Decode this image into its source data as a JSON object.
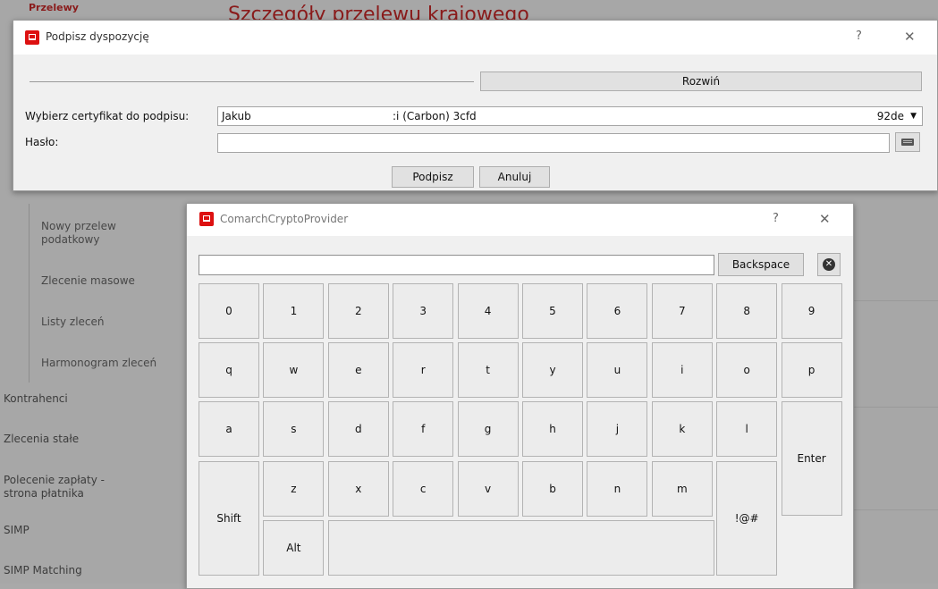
{
  "background": {
    "breadcrumb": "Przelewy",
    "heading": "Szczegóły przelewu krajowego",
    "nav": {
      "tax_transfer": "Nowy przelew\npodatkowy",
      "mass_order": "Zlecenie masowe",
      "order_lists": "Listy zleceń",
      "order_schedule": "Harmonogram zleceń",
      "contractors": "Kontrahenci",
      "standing_orders": "Zlecenia stałe",
      "direct_debit": "Polecenie zapłaty -\nstrona płatnika",
      "simp": "SIMP",
      "simp_matching": "SIMP Matching"
    }
  },
  "sign_dialog": {
    "title": "Podpisz dyspozycję",
    "help": "?",
    "close": "✕",
    "expand_label": "Rozwiń",
    "certificate_label": "Wybierz certyfikat do podpisu:",
    "certificate_value_start": "Jakub",
    "certificate_value_mid": ":i (Carbon) 3cfd",
    "certificate_value_end": "92de",
    "password_label": "Hasło:",
    "password_value": "",
    "sign_label": "Podpisz",
    "cancel_label": "Anuluj"
  },
  "keyboard_dialog": {
    "title": "ComarchCryptoProvider",
    "help": "?",
    "close": "✕",
    "input_value": "",
    "backspace_label": "Backspace",
    "clear_glyph": "✕",
    "row1": [
      "0",
      "1",
      "2",
      "3",
      "4",
      "5",
      "6",
      "7",
      "8",
      "9"
    ],
    "row2": [
      "q",
      "w",
      "e",
      "r",
      "t",
      "y",
      "u",
      "i",
      "o",
      "p"
    ],
    "row3": [
      "a",
      "s",
      "d",
      "f",
      "g",
      "h",
      "j",
      "k",
      "l"
    ],
    "row4": [
      "z",
      "x",
      "c",
      "v",
      "b",
      "n",
      "m"
    ],
    "enter_label": "Enter",
    "shift_label": "Shift",
    "alt_label": "Alt",
    "symbols_label": "!@#",
    "space_label": ""
  },
  "colors": {
    "accent": "#dd1111",
    "dialog_bg": "#f0f0f0",
    "overlay": "#a7a7a7"
  }
}
